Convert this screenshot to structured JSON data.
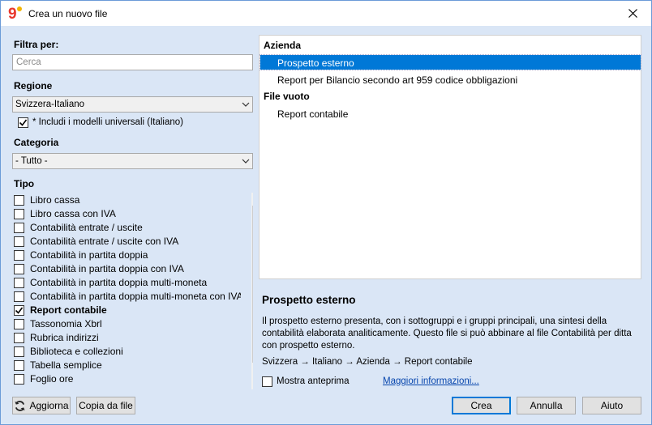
{
  "window": {
    "title": "Crea un nuovo file",
    "brand_color": "#e8372c"
  },
  "filter": {
    "label": "Filtra per:",
    "placeholder": "Cerca"
  },
  "region": {
    "label": "Regione",
    "selected": "Svizzera-Italiano",
    "include_universal": {
      "label": "* Includi i modelli universali (Italiano)",
      "checked": true
    }
  },
  "category": {
    "label": "Categoria",
    "selected": "- Tutto -"
  },
  "tipo": {
    "label": "Tipo",
    "items": [
      {
        "label": "Libro cassa",
        "checked": false,
        "bold": false
      },
      {
        "label": "Libro cassa con IVA",
        "checked": false,
        "bold": false
      },
      {
        "label": "Contabilità entrate / uscite",
        "checked": false,
        "bold": false
      },
      {
        "label": "Contabilità entrate / uscite con IVA",
        "checked": false,
        "bold": false
      },
      {
        "label": "Contabilità in partita doppia",
        "checked": false,
        "bold": false
      },
      {
        "label": "Contabilità in partita doppia con IVA",
        "checked": false,
        "bold": false
      },
      {
        "label": "Contabilità in partita doppia multi-moneta",
        "checked": false,
        "bold": false
      },
      {
        "label": "Contabilità in partita doppia multi-moneta con IVA",
        "checked": false,
        "bold": false
      },
      {
        "label": "Report contabile",
        "checked": true,
        "bold": true
      },
      {
        "label": "Tassonomia Xbrl",
        "checked": false,
        "bold": false
      },
      {
        "label": "Rubrica indirizzi",
        "checked": false,
        "bold": false
      },
      {
        "label": "Biblioteca e collezioni",
        "checked": false,
        "bold": false
      },
      {
        "label": "Tabella semplice",
        "checked": false,
        "bold": false
      },
      {
        "label": "Foglio ore",
        "checked": false,
        "bold": false
      }
    ]
  },
  "templates": {
    "groups": [
      {
        "label": "Azienda",
        "items": [
          "Prospetto esterno",
          "Report per Bilancio secondo art 959 codice obbligazioni"
        ]
      },
      {
        "label": "File vuoto",
        "items": [
          "Report contabile"
        ]
      }
    ],
    "selected": "Prospetto esterno"
  },
  "details": {
    "title": "Prospetto esterno",
    "description": "Il prospetto esterno presenta, con i sottogruppi e i gruppi principali, una sintesi della contabilità elaborata analiticamente. Questo file si può abbinare al file Contabilità per ditta con prospetto esterno.",
    "path": "Svizzera → Italiano → Azienda → Report contabile",
    "preview_label": "Mostra anteprima",
    "more_info": "Maggiori informazioni..."
  },
  "buttons": {
    "refresh": "Aggiorna",
    "copy_from_file": "Copia da file",
    "create": "Crea",
    "cancel": "Annulla",
    "help": "Aiuto"
  }
}
